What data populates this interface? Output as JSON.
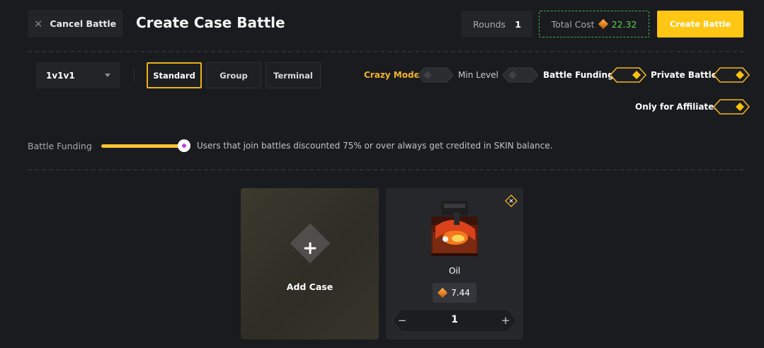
{
  "header": {
    "cancel_label": "Cancel Battle",
    "title": "Create Case Battle",
    "rounds_label": "Rounds",
    "rounds_value": "1",
    "total_cost_label": "Total Cost",
    "total_cost_value": "22.32",
    "create_label": "Create Battle"
  },
  "settings": {
    "mode_select_value": "1v1v1",
    "types": [
      {
        "label": "Standard",
        "active": true
      },
      {
        "label": "Group",
        "active": false
      },
      {
        "label": "Terminal",
        "active": false
      }
    ],
    "options": [
      {
        "label": "Crazy Mode",
        "enabled": false
      },
      {
        "label": "Min Level",
        "enabled": false
      },
      {
        "label": "Battle Funding",
        "enabled": true
      },
      {
        "label": "Private Battle",
        "enabled": true
      },
      {
        "label": "Only for Affiliates",
        "enabled": true
      }
    ]
  },
  "funding": {
    "label": "Battle Funding",
    "slider_fraction": 1.0,
    "note": "Users that join battles discounted 75% or over always get credited in SKIN balance."
  },
  "cases": {
    "add_label": "Add Case",
    "items": [
      {
        "name": "Oil",
        "price": "7.44",
        "quantity": "1"
      }
    ]
  },
  "colors": {
    "accent": "#ffc613",
    "background": "#1a1b1e",
    "cost_green": "#5fd04f"
  },
  "icons": {
    "cancel": "close-icon",
    "coin": "gem-icon",
    "add": "plus-icon",
    "remove": "close-icon",
    "decrement": "minus-icon",
    "increment": "plus-icon",
    "dropdown": "chevron-down-icon"
  }
}
